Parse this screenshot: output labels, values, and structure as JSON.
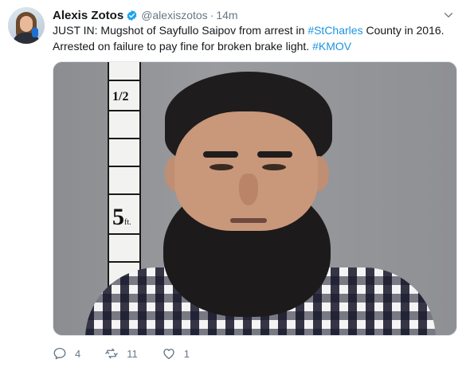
{
  "tweet": {
    "author": {
      "name": "Alexis Zotos",
      "handle": "@alexiszotos",
      "separator": "·",
      "time": "14m",
      "verified": true
    },
    "text": {
      "line1_a": "JUST IN: Mugshot of Sayfullo Saipov from arrest in ",
      "line1_tag": "#StCharles",
      "line1_b": " County in 2016.",
      "line2_a": "Arrested on failure to pay fine for broken brake light. ",
      "line2_tag": "#KMOV"
    },
    "media": {
      "ruler_half_label": "1/2",
      "ruler_five_label": "5",
      "ruler_five_unit": "ft."
    },
    "actions": {
      "reply_count": "4",
      "retweet_count": "11",
      "like_count": "1"
    }
  },
  "colors": {
    "link": "#1b95e0",
    "verified": "#1da1f2",
    "muted": "#657786",
    "text": "#14171a"
  },
  "icons": {
    "reply": "reply-icon",
    "retweet": "retweet-icon",
    "like": "like-icon",
    "verified": "verified-badge-icon",
    "caret": "chevron-down-icon"
  }
}
